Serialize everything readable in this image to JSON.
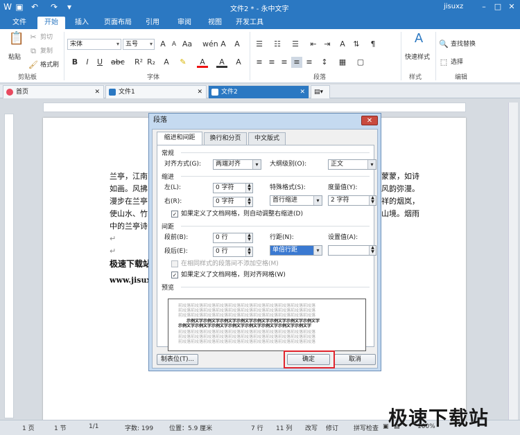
{
  "window": {
    "title": "文件2 * - 永中文字",
    "user": "jisuxz",
    "qat_icons": [
      "app-icon",
      "save-icon",
      "undo-icon",
      "redo-icon",
      "customize-icon"
    ]
  },
  "menu_tabs": [
    "文件",
    "开始",
    "插入",
    "页面布局",
    "引用",
    "审阅",
    "视图",
    "开发工具"
  ],
  "ribbon": {
    "clipboard": {
      "paste": "粘贴",
      "cut": "剪切",
      "copy": "复制",
      "format_painter": "格式刷",
      "group": "剪贴板"
    },
    "font": {
      "name": "宋体",
      "size": "五号",
      "group": "字体"
    },
    "paragraph": {
      "group": "段落"
    },
    "styles": {
      "quick": "快速样式",
      "group": "样式"
    },
    "edit": {
      "find": "查找替换",
      "select": "选择",
      "group": "编辑"
    }
  },
  "doc_tabs": [
    {
      "label": "首页"
    },
    {
      "label": "文件1"
    },
    {
      "label": "文件2"
    }
  ],
  "document": {
    "lines": [
      "兰亭，江南",
      "如画。风拂",
      "漫步在兰亭",
      "使山水、竹",
      "中的兰亭诗",
      "↵",
      "↵",
      "极速下载站",
      "www.jisux"
    ],
    "right_lines": [
      "蒙蒙，如诗",
      "风韵弥漫。",
      "祥的烟岚，",
      "山境。烟雨"
    ]
  },
  "dialog": {
    "title": "段落",
    "tabs": [
      "缩进和间距",
      "换行和分页",
      "中文版式"
    ],
    "general": {
      "section": "常规",
      "align_label": "对齐方式(G):",
      "align_value": "两端对齐",
      "outline_label": "大纲级别(O):",
      "outline_value": "正文"
    },
    "indent": {
      "section": "缩进",
      "left_label": "左(L):",
      "left_value": "0 字符",
      "right_label": "右(R):",
      "right_value": "0 字符",
      "special_label": "特殊格式(S):",
      "special_value": "首行缩进",
      "measure_label": "度量值(Y):",
      "measure_value": "2 字符",
      "auto_adjust": "如果定义了文档网格，则自动调整右缩进(D)"
    },
    "spacing": {
      "section": "间距",
      "before_label": "段前(B):",
      "before_value": "0 行",
      "after_label": "段后(E):",
      "after_value": "0 行",
      "line_label": "行距(N):",
      "line_value": "单倍行距",
      "setting_label": "设置值(A):",
      "setting_value": "",
      "no_space": "在相同样式的段落间不添加空格(M)",
      "snap_grid": "如果定义了文档网格，则对齐网格(W)"
    },
    "preview": {
      "section": "预览",
      "sample_light": "前段落前段落前段落前段落前段落前段落前段落前段落前段落前段落前段落",
      "sample_dark": "示例文字示例文字示例文字示例文字示例文字示例文字示例文字示例文字"
    },
    "buttons": {
      "tabs": "制表位(T)...",
      "ok": "确定",
      "cancel": "取消"
    }
  },
  "status": {
    "page": "1 页",
    "section": "1 节",
    "pages": "1/1",
    "words": "字数: 199",
    "position": "位置：5.9 厘米",
    "line": "7 行",
    "col": "11 列",
    "overtype": "改写",
    "revise": "修订",
    "spell": "拼写检查",
    "zoom": "100%"
  },
  "watermark": "极速下载站"
}
